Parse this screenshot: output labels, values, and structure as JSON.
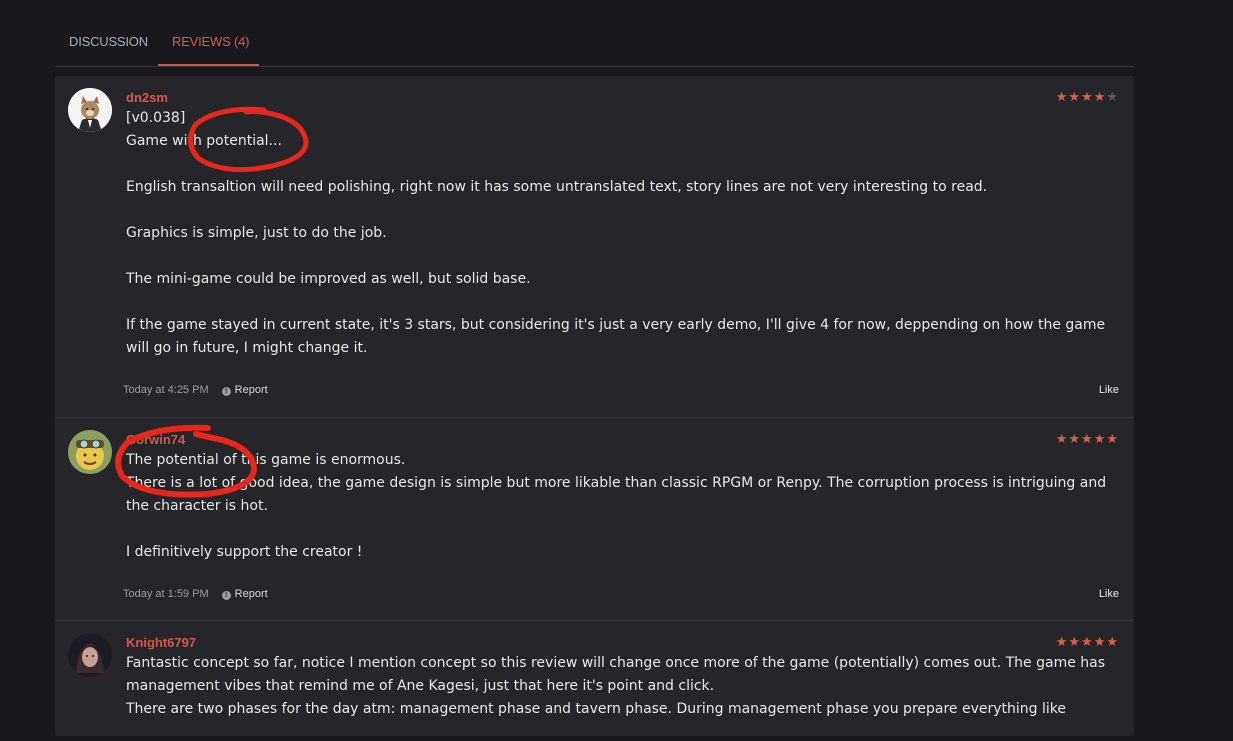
{
  "tabs": [
    {
      "label": "DISCUSSION"
    },
    {
      "label": "REVIEWS (4)"
    }
  ],
  "colors": {
    "accent": "#d4584a",
    "star_on": "#d9604e",
    "annotation": "#e8261c"
  },
  "reviews": [
    {
      "username": "dn2sm",
      "rating": 4,
      "lines": [
        "[v0.038]",
        "Game with potential...",
        "",
        "English transaltion will need polishing, right now it has some untranslated text, story lines are not very interesting to read.",
        "",
        "Graphics is simple, just to do the job.",
        "",
        "The mini-game could be improved as well, but solid base.",
        "",
        "If the game stayed in current state, it's 3 stars, but considering it's just a very early demo, I'll give 4 for now, deppending on how the game will go in future, I might change it."
      ],
      "time": "Today at 4:25 PM",
      "report": "Report",
      "like": "Like"
    },
    {
      "username": "Gorwin74",
      "rating": 5,
      "lines": [
        "The potential of this game is enormous.",
        "There is a lot of good idea, the game design is simple but more likable than classic RPGM or Renpy. The corruption process is intriguing and the character is hot.",
        "",
        "I definitively support the creator !"
      ],
      "time": "Today at 1:59 PM",
      "report": "Report",
      "like": "Like"
    },
    {
      "username": "Knight6797",
      "rating": 5,
      "lines": [
        "Fantastic concept so far, notice I mention concept so this review will change once more of the game (potentially) comes out. The game has management vibes that remind me of Ane Kagesi, just that here it's point and click.",
        "There are two phases for the day atm: management phase and tavern phase. During management phase you prepare everything like"
      ]
    }
  ]
}
